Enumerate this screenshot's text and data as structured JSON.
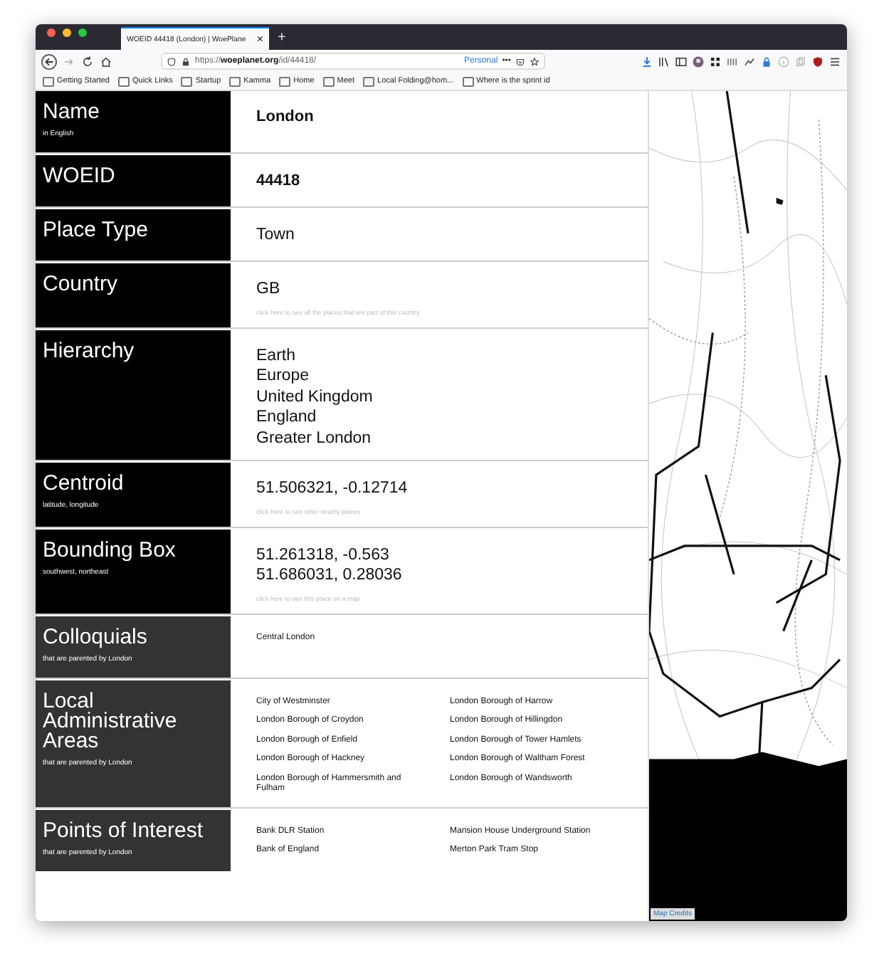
{
  "browser": {
    "tab": {
      "title": "WOEID 44418 (London) | WoePlane",
      "selected": true
    },
    "url": "https://**woeplanet.org**/id/44418/",
    "container": "Personal",
    "more": "•••",
    "new_tab": "+",
    "close": "×",
    "bookmarks": [
      "Getting Started",
      "Quick Links",
      "Startup",
      "Kamma",
      "Home",
      "Meet",
      "Local Folding@hom...",
      "Where is the sprint id"
    ]
  },
  "rows": [
    {
      "label": "Name",
      "sublabel": "in English",
      "color": "#000000",
      "kind": "single",
      "bold": true,
      "values": [
        "London"
      ]
    },
    {
      "label": "WOEID",
      "color": "#000000",
      "kind": "single",
      "bold": true,
      "values": [
        "44418"
      ]
    },
    {
      "label": "Place Type",
      "color": "#000000",
      "kind": "single",
      "bold": false,
      "values": [
        "Town"
      ]
    },
    {
      "label": "Country",
      "color": "#000000",
      "kind": "single",
      "bold": false,
      "values": [
        "GB"
      ],
      "hint": "click here to see all the places that are part of this country"
    },
    {
      "label": "Hierarchy",
      "color": "#000000",
      "kind": "single",
      "bold": false,
      "values": [
        "Earth",
        "Europe",
        "United Kingdom",
        "England",
        "Greater London"
      ]
    },
    {
      "label": "Centroid",
      "sublabel": "latitude, longitude",
      "color": "#000000",
      "kind": "single",
      "bold": false,
      "values": [
        "51.506321, -0.12714"
      ],
      "hint": "click here to see other nearby places"
    },
    {
      "label": "Bounding Box",
      "sublabel": "southwest, northeast",
      "color": "#000000",
      "kind": "single",
      "bold": false,
      "values": [
        "51.261318, -0.563",
        "51.686031, 0.28036"
      ],
      "hint": "click here to see this place on a map"
    },
    {
      "label": "Colloquials",
      "sublabel": "that are parented by London",
      "color": "#333333",
      "kind": "list",
      "items": [
        "Central London"
      ]
    },
    {
      "label": "Local Administrative Areas",
      "sublabel": "that are parented by London",
      "color": "#333333",
      "kind": "list",
      "items": [
        "City of Westminster",
        "London Borough of Harrow",
        "London Borough of Croydon",
        "London Borough of Hillingdon",
        "London Borough of Enfield",
        "London Borough of Tower Hamlets",
        "London Borough of Hackney",
        "London Borough of Waltham Forest",
        "London Borough of Hammersmith and Fulham",
        "London Borough of Wandsworth"
      ]
    },
    {
      "label": "Points of Interest",
      "sublabel": "that are parented by London",
      "color": "#333333",
      "kind": "list",
      "items": [
        "Bank DLR Station",
        "Mansion House Underground Station",
        "Bank of England",
        "Merton Park Tram Stop"
      ]
    }
  ],
  "map": {
    "credits": "Map Credits"
  }
}
